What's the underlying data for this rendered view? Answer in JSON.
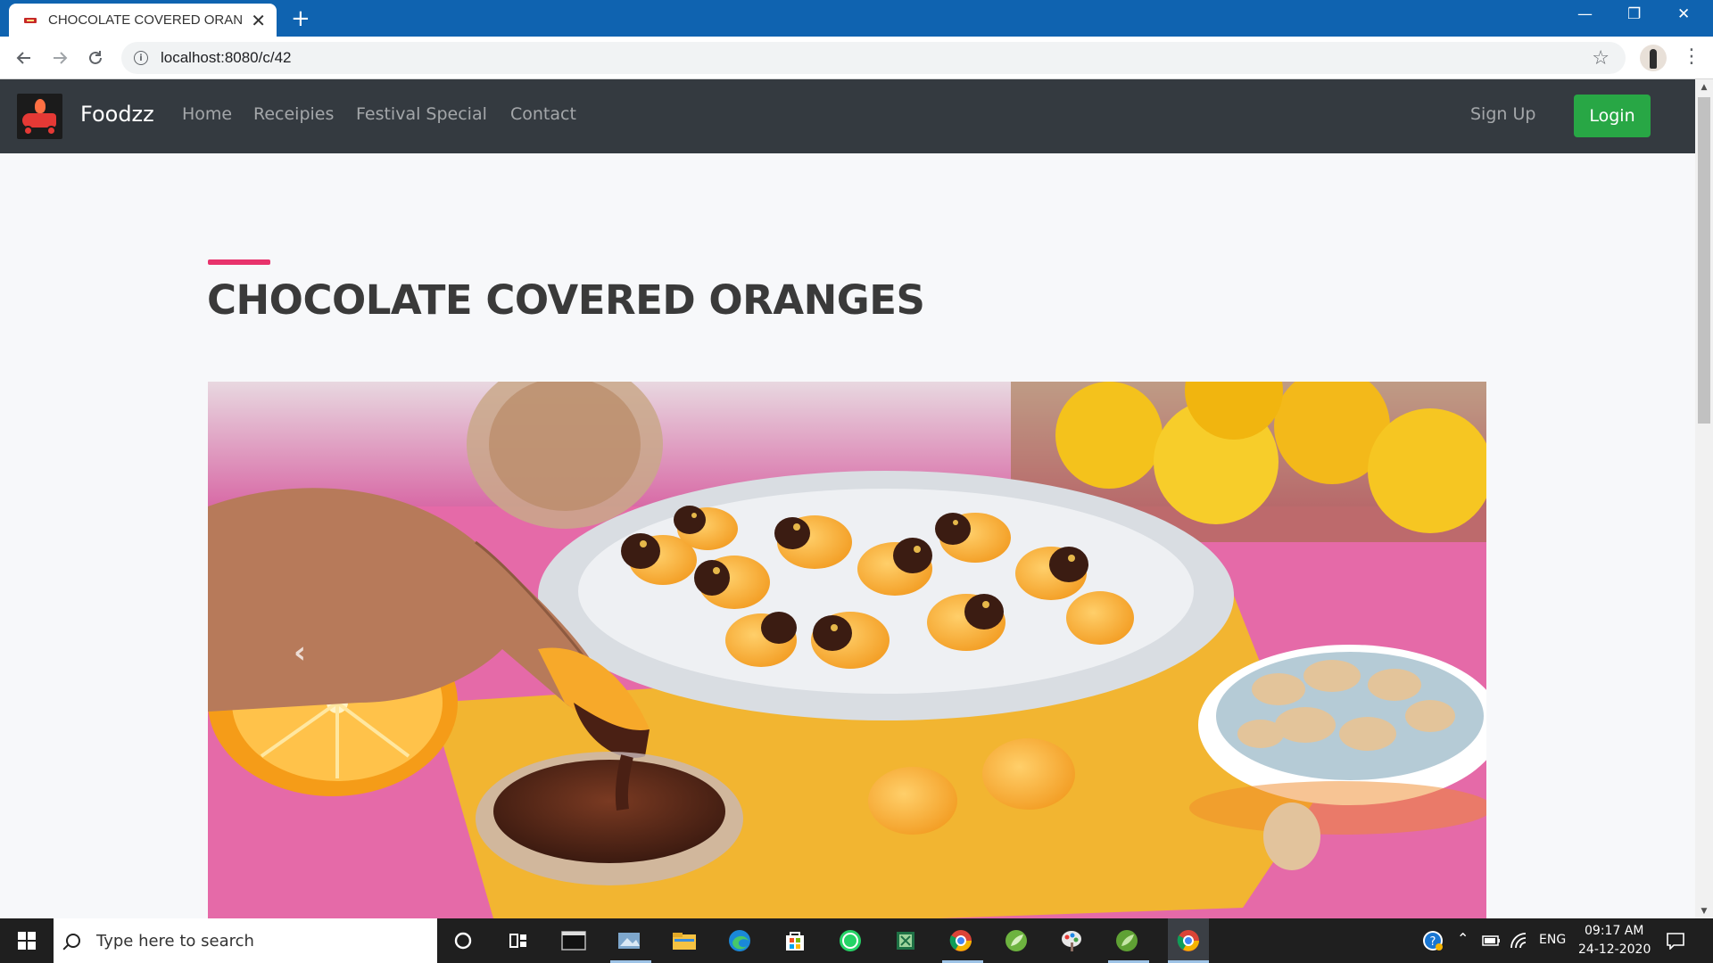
{
  "browser": {
    "tab_title": "CHOCOLATE COVERED ORANGES",
    "tab_close": "✕",
    "new_tab": "+",
    "url": "localhost:8080/c/42",
    "window_controls": {
      "minimize": "—",
      "restore": "❐",
      "close": "✕"
    }
  },
  "site": {
    "brand": "Foodzz",
    "nav": [
      "Home",
      "Receipies",
      "Festival Special",
      "Contact"
    ],
    "signup": "Sign Up",
    "login": "Login"
  },
  "page": {
    "title": "CHOCOLATE COVERED ORANGES",
    "carousel_prev": "‹"
  },
  "taskbar": {
    "search_placeholder": "Type here to search",
    "language": "ENG",
    "time": "09:17 AM",
    "date": "24-12-2020",
    "pinned_icons": [
      "cortana-icon",
      "task-view-icon",
      "terminal-icon",
      "photos-icon",
      "file-explorer-icon",
      "edge-icon",
      "store-icon",
      "whatsapp-icon",
      "excel-icon",
      "chrome-alt-icon",
      "spring-icon",
      "paint-icon",
      "spring-tools-icon",
      "chrome-icon"
    ]
  },
  "colors": {
    "tabbar": "#0f63b0",
    "navbar": "#343a40",
    "accent": "#e8336c",
    "login": "#28a745",
    "title": "#3a3a3a"
  }
}
